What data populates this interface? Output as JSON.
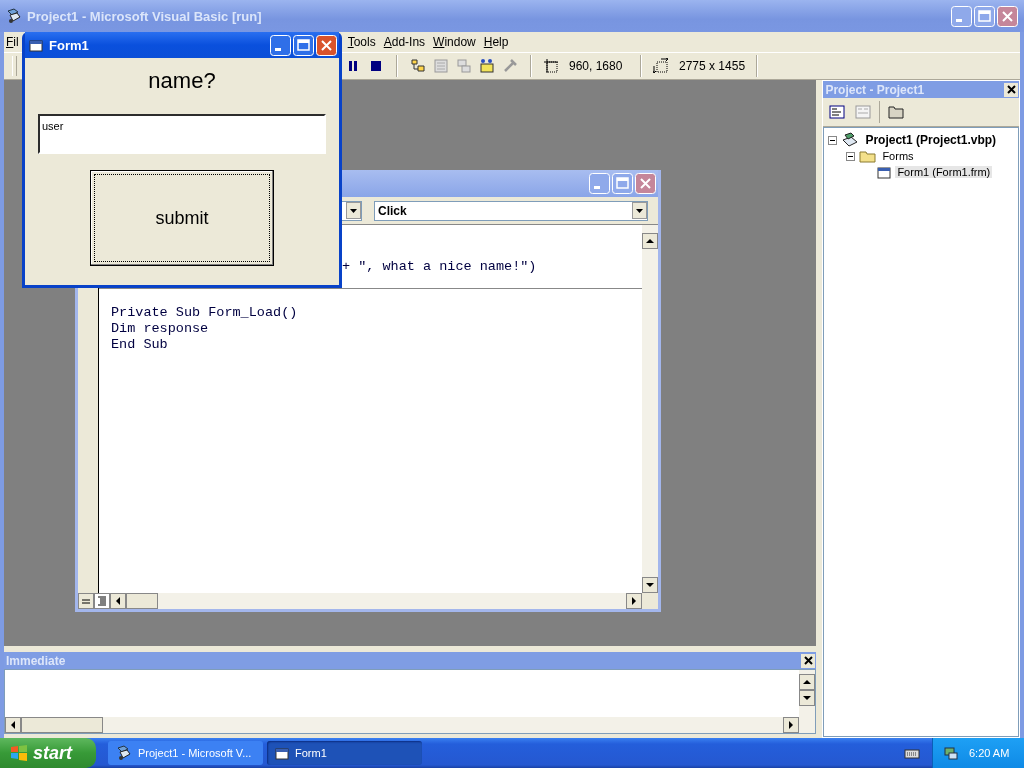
{
  "main_window": {
    "title": "Project1 - Microsoft Visual Basic [run]",
    "menu": [
      {
        "label": "Fil"
      },
      {
        "label": "Tools"
      },
      {
        "label": "Add-Ins"
      },
      {
        "label": "Window"
      },
      {
        "label": "Help"
      }
    ],
    "toolbar": {
      "position": "960, 1680",
      "size": "2775 x 1455"
    }
  },
  "code_window": {
    "procedure": "Click",
    "procedures": [
      {
        "lines": [
          "+ \", what a nice name!\")"
        ]
      },
      {
        "lines": [
          "Private Sub Form_Load()",
          "Dim response",
          "End Sub"
        ]
      }
    ]
  },
  "form_window": {
    "title": "Form1",
    "label": "name?",
    "textbox": {
      "value": "user"
    },
    "button": "submit"
  },
  "project_panel": {
    "title": "Project - Project1",
    "tree": [
      {
        "label": "Project1 (Project1.vbp)",
        "expanded": true,
        "selected": false,
        "children": [
          {
            "label": "Forms",
            "expanded": true,
            "selected": false,
            "children": [
              {
                "label": "Form1 (Form1.frm)",
                "selected": true
              }
            ]
          }
        ]
      }
    ]
  },
  "immediate": {
    "title": "Immediate"
  },
  "taskbar": {
    "start": "start",
    "tasks": [
      {
        "label": "Project1 - Microsoft V...",
        "selected": false
      },
      {
        "label": "Form1",
        "selected": true
      }
    ],
    "clock": "6:20 AM"
  }
}
